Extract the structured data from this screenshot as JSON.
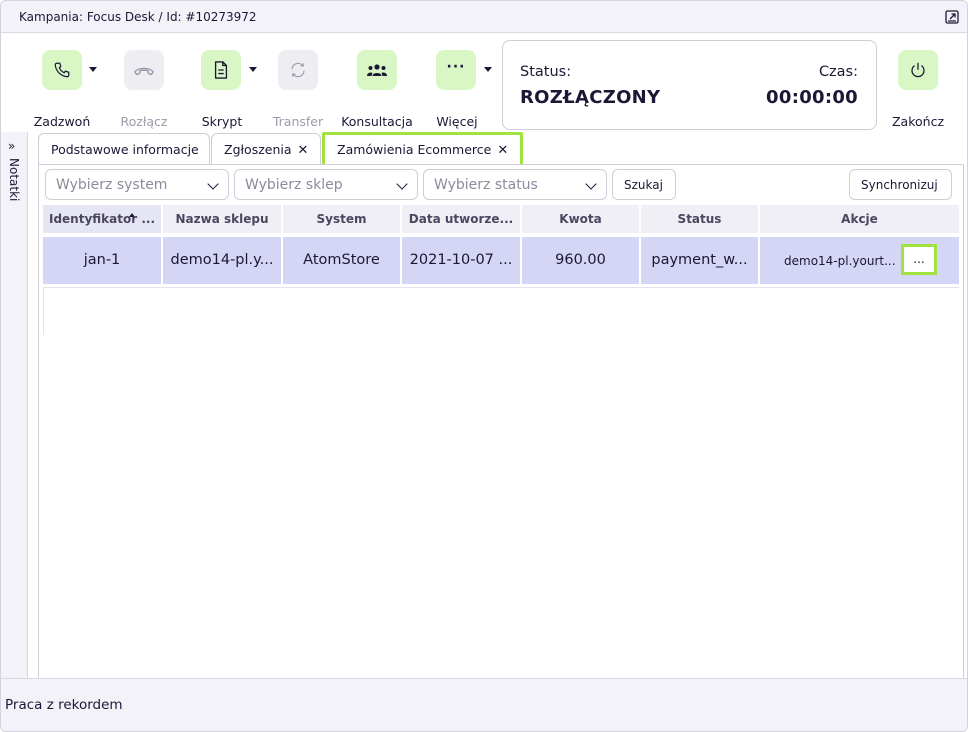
{
  "window": {
    "title": "Kampania: Focus Desk / Id: #10273972"
  },
  "toolbar": {
    "call_label": "Zadzwoń",
    "disconnect_label": "Rozłącz",
    "script_label": "Skrypt",
    "transfer_label": "Transfer",
    "consult_label": "Konsultacja",
    "more_label": "Więcej",
    "end_label": "Zakończ"
  },
  "status": {
    "status_label": "Status:",
    "status_value": "ROZŁĄCZONY",
    "time_label": "Czas:",
    "time_value": "00:00:00"
  },
  "notes": {
    "label": "Notatki"
  },
  "tabs": [
    {
      "label": "Podstawowe informacje",
      "closable": false,
      "active": false
    },
    {
      "label": "Zgłoszenia",
      "closable": true,
      "active": false
    },
    {
      "label": "Zamówienia Ecommerce",
      "closable": true,
      "active": true
    }
  ],
  "filters": {
    "system_placeholder": "Wybierz system",
    "shop_placeholder": "Wybierz sklep",
    "status_placeholder": "Wybierz status",
    "search_label": "Szukaj",
    "sync_label": "Synchronizuj"
  },
  "table": {
    "columns": [
      "Identyfikator ...",
      "Nazwa sklepu",
      "System",
      "Data utworze...",
      "Kwota",
      "Status",
      "Akcje"
    ],
    "rows": [
      [
        "jan-1",
        "demo14-pl.y...",
        "AtomStore",
        "2021-10-07 ...",
        "960.00",
        "payment_w...",
        "demo14-pl.yourt..."
      ]
    ],
    "action_more_label": "..."
  },
  "footer": {
    "label": "Praca z rekordem"
  },
  "colors": {
    "accent_green": "#a1e33c",
    "active_icon_bg": "#d9f7c5",
    "row_selected": "#d5d5f6",
    "text_dark": "#1b1836"
  }
}
